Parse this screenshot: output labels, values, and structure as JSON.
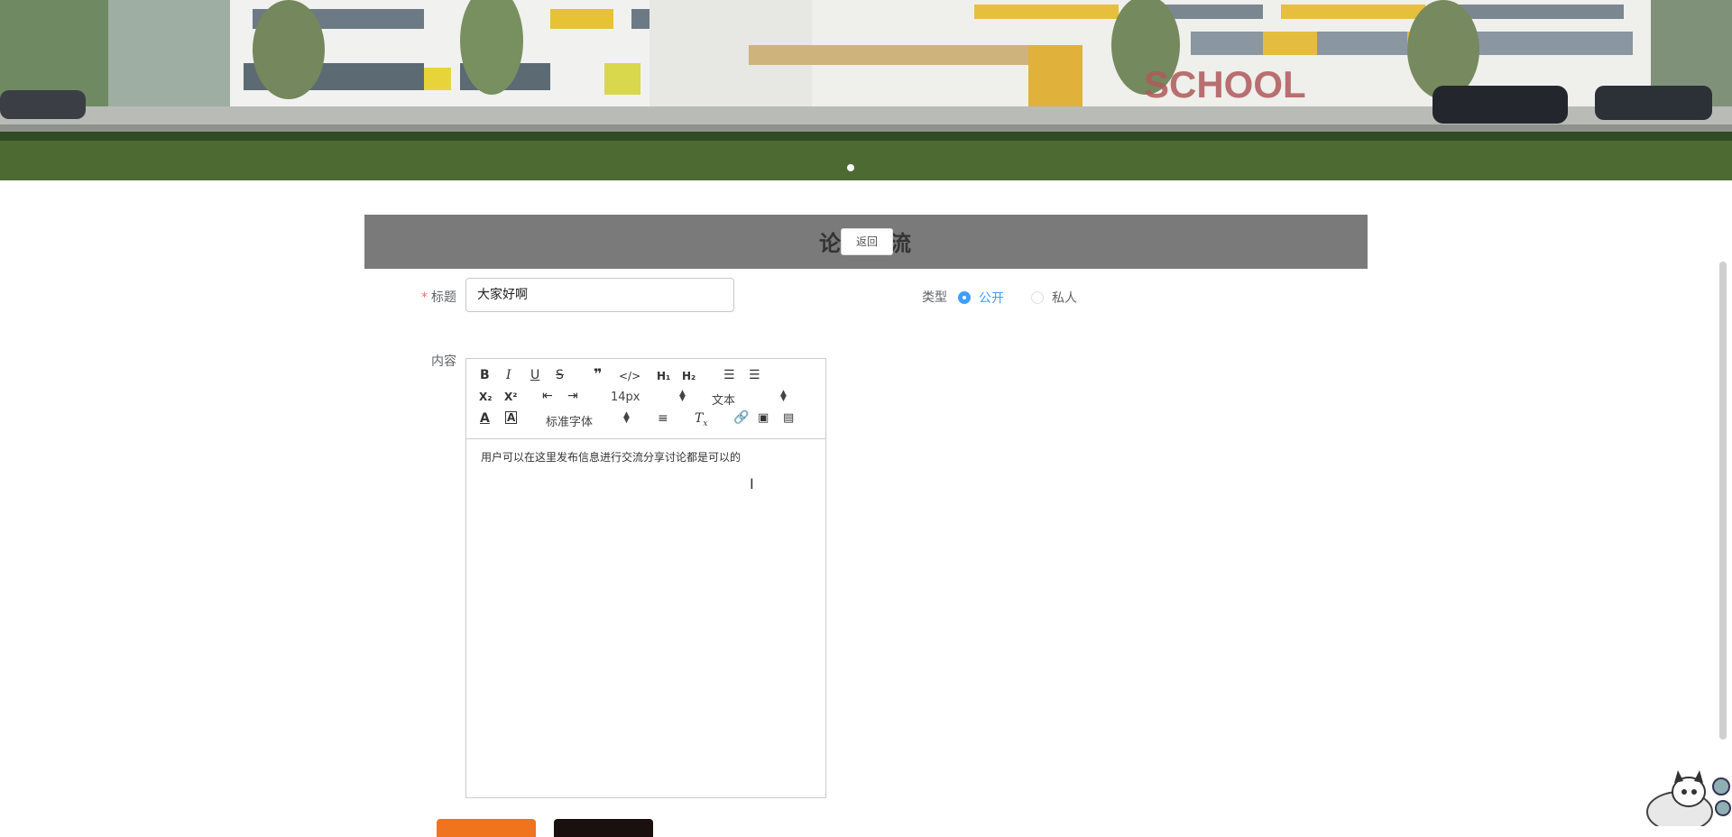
{
  "banner": {
    "sign_text": "SCHOOL"
  },
  "page": {
    "title": "论坛交流",
    "back_label": "返回"
  },
  "form": {
    "title_label": "标题",
    "title_value": "大家好啊",
    "type_label": "类型",
    "type_options": [
      "公开",
      "私人"
    ],
    "type_selected": "公开",
    "content_label": "内容"
  },
  "editor": {
    "font_size": "14px",
    "block_type": "文本",
    "font_family": "标准字体",
    "content": "用户可以在这里发布信息进行交流分享讨论都是可以的"
  },
  "colors": {
    "header_bar": "#7a7a7a",
    "accent": "#409eff",
    "submit": "#f0731e",
    "cancel": "#1a1010"
  }
}
